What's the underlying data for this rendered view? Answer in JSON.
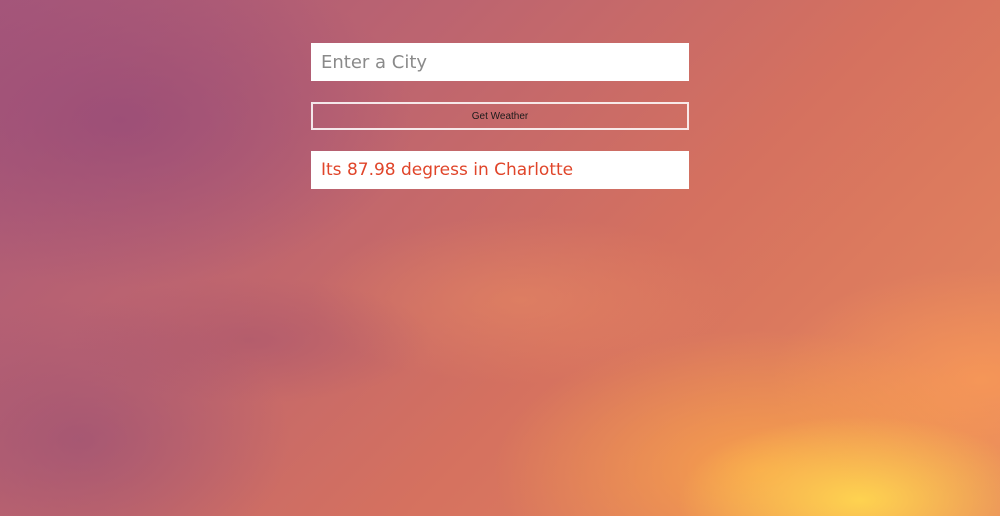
{
  "city_input": {
    "value": "",
    "placeholder": "Enter a City"
  },
  "weather_button": {
    "label": "Get Weather"
  },
  "result": {
    "text": "Its 87.98 degress in Charlotte"
  },
  "colors": {
    "result_text": "#e0452a",
    "button_border": "#ffffff",
    "background_top": "#a6577a",
    "background_bottom": "#e88a5d"
  }
}
